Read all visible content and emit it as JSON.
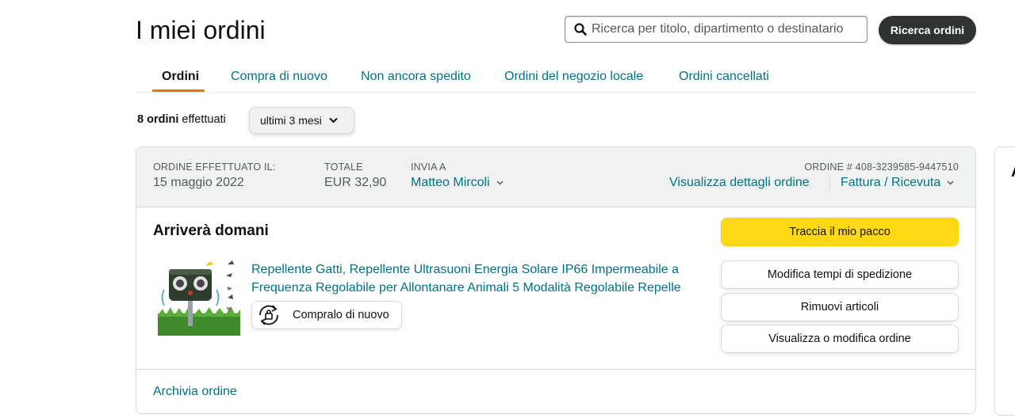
{
  "page": {
    "title": "I miei ordini"
  },
  "search": {
    "placeholder": "Ricerca per titolo, dipartimento o destinatario",
    "button_label": "Ricerca ordini"
  },
  "tabs": [
    {
      "label": "Ordini",
      "active": true
    },
    {
      "label": "Compra di nuovo",
      "active": false
    },
    {
      "label": "Non ancora spedito",
      "active": false
    },
    {
      "label": "Ordini del negozio locale",
      "active": false
    },
    {
      "label": "Ordini cancellati",
      "active": false
    }
  ],
  "summary": {
    "count_text": "8 ordini",
    "suffix_text": "effettuati",
    "range_selected": "ultimi 3 mesi"
  },
  "order": {
    "placed_label": "ORDINE EFFETTUATO IL:",
    "placed_date": "15 maggio 2022",
    "total_label": "TOTALE",
    "total_value": "EUR 32,90",
    "ship_to_label": "INVIA A",
    "ship_to_name": "Matteo Mircoli",
    "order_number_label": "ORDINE # 408-3239585-9447510",
    "details_link": "Visualizza dettagli ordine",
    "invoice_link": "Fattura / Ricevuta",
    "status": "Arriverà domani",
    "product_title": "Repellente Gatti, Repellente Ultrasuoni Energia Solare IP66 Impermeabile a Frequenza Regolabile per Allontanare Animali 5 Modalità Regolabile Repelle",
    "buy_again_label": "Compralo di nuovo",
    "actions": {
      "track": "Traccia il mio pacco",
      "modify_shipping": "Modifica tempi di spedizione",
      "remove_items": "Rimuovi articoli",
      "view_modify": "Visualizza o modifica ordine"
    },
    "archive_link": "Archivia ordine"
  },
  "side_panel": {
    "letter": "A"
  },
  "colors": {
    "link": "#007185",
    "primary_button": "#ffd814",
    "tab_underline": "#e77600",
    "dark_button": "#303333"
  }
}
